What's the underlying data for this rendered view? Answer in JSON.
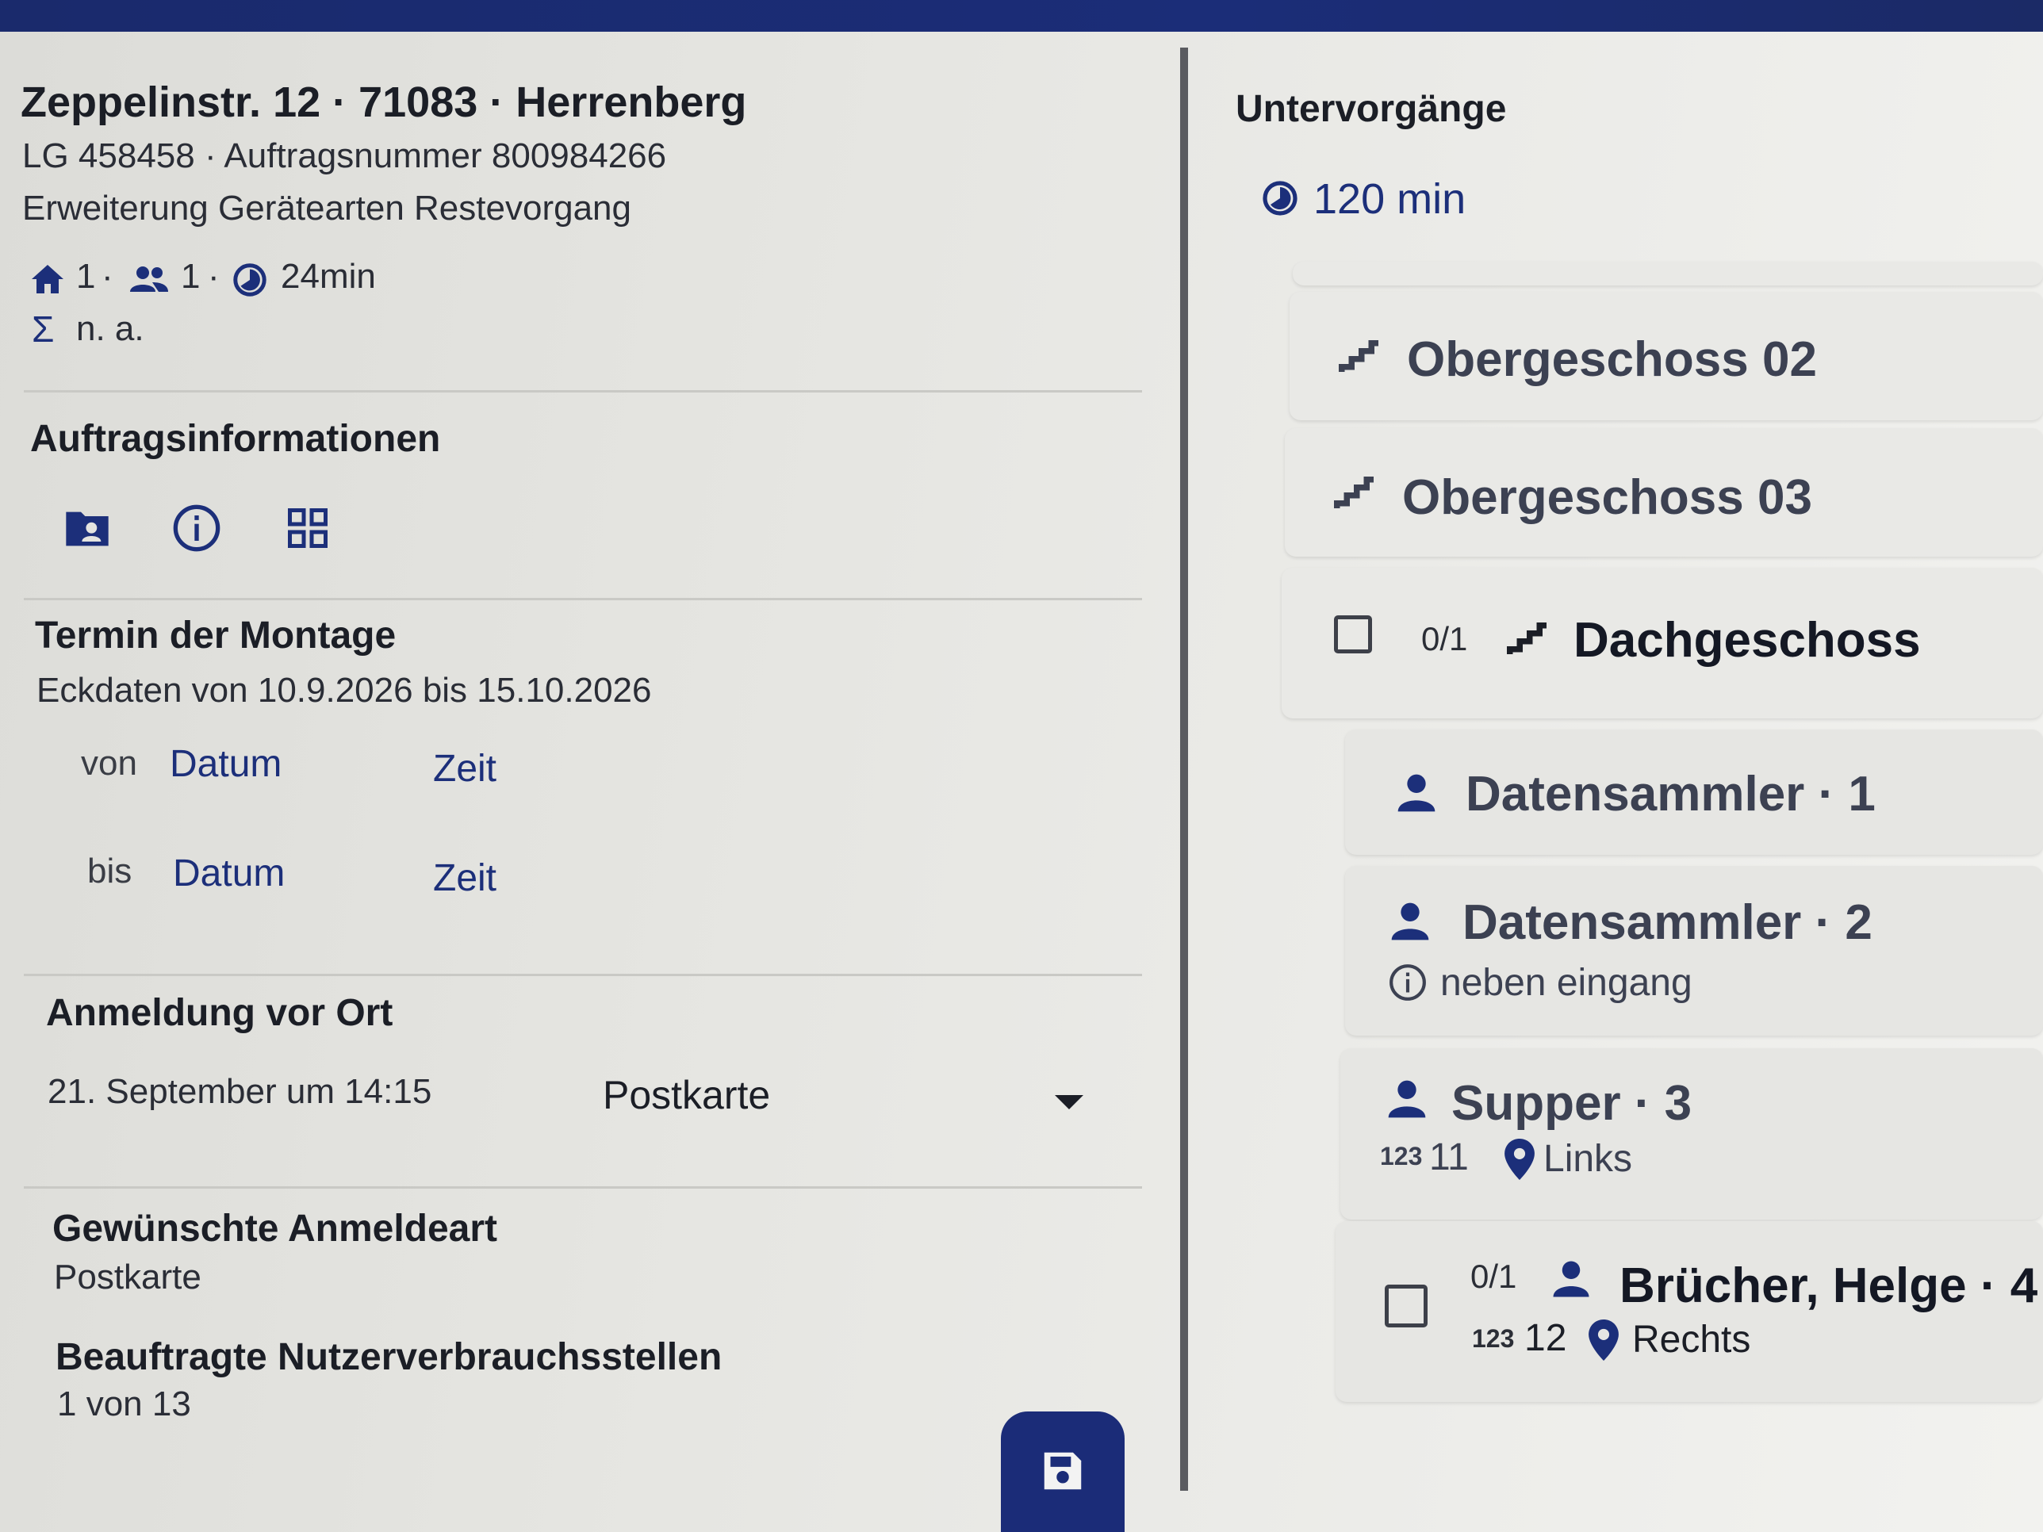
{
  "job": {
    "address": "Zeppelinstr. 12 · 71083 · Herrenberg",
    "order_line": "LG 458458 · Auftragsnummer 800984266",
    "description": "Erweiterung Gerätearten Restevorgang",
    "stats": {
      "homes": "1",
      "persons": "1",
      "duration": "24min"
    },
    "sum_value": "n. a."
  },
  "auftragsinfo": {
    "title": "Auftragsinformationen",
    "icons": [
      "folder-account-icon",
      "info-circle-icon",
      "qr-code-icon"
    ]
  },
  "termin": {
    "title": "Termin der Montage",
    "range": "Eckdaten von 10.9.2026 bis 15.10.2026",
    "from_label": "von",
    "to_label": "bis",
    "date_label": "Datum",
    "time_label": "Zeit"
  },
  "anmeldung": {
    "title": "Anmeldung vor Ort",
    "datetime": "21. September um 14:15",
    "method": "Postkarte"
  },
  "wunsch": {
    "title": "Gewünschte Anmeldeart",
    "value": "Postkarte"
  },
  "nutzer": {
    "title": "Beauftragte Nutzerverbrauchsstellen",
    "value": "1 von 13"
  },
  "untervorgaenge": {
    "title": "Untervorgänge",
    "duration": "120 min",
    "floors": [
      {
        "label": "Obergeschoss 02"
      },
      {
        "label": "Obergeschoss 03"
      },
      {
        "label": "Dachgeschoss",
        "progress": "0/1"
      }
    ],
    "units": [
      {
        "name": "Datensammler · 1"
      },
      {
        "name": "Datensammler · 2",
        "note": "neben eingang"
      },
      {
        "name": "Supper · 3",
        "number": "11",
        "position": "Links"
      },
      {
        "name": "Brücher, Helge · 4",
        "progress": "0/1",
        "number": "12",
        "position": "Rechts"
      }
    ]
  },
  "colors": {
    "accent": "#1c2f7a",
    "topbar": "#1a2a6c",
    "fab": "#1b2c78"
  }
}
